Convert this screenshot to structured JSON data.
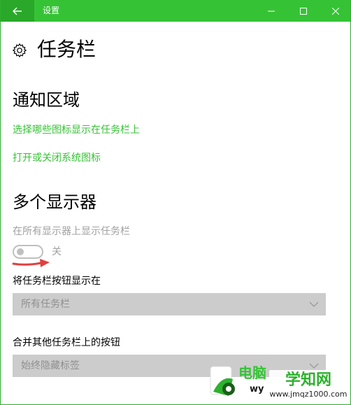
{
  "titlebar": {
    "title": "设置",
    "back_icon": "back-arrow-icon",
    "minimize_icon": "minimize-icon",
    "maximize_icon": "maximize-icon",
    "close_icon": "close-icon",
    "color": "#35c335"
  },
  "page": {
    "title": "任务栏",
    "icon": "gear-icon"
  },
  "notification_area": {
    "heading": "通知区域",
    "link_select_icons": "选择哪些图标显示在任务栏上",
    "link_system_icons": "打开或关闭系统图标"
  },
  "multiple_displays": {
    "heading": "多个显示器",
    "show_on_all_label": "在所有显示器上显示任务栏",
    "toggle_state": "关",
    "toggle_on": false,
    "buttons_on_label": "将任务栏按钮显示在",
    "buttons_on_value": "所有任务栏",
    "combine_label": "合并其他任务栏上的按钮",
    "combine_value": "始终隐藏标签"
  },
  "annotation": {
    "arrow_color": "#e04040"
  },
  "watermark": {
    "site_text_1": "电脑",
    "site_text_2": "wy",
    "badge_title": "学知网",
    "badge_url": "www.jmqz1000.com"
  },
  "colors": {
    "accent": "#35c335",
    "disabled_text": "#a0a0a0",
    "dropdown_bg": "#cccccc"
  }
}
